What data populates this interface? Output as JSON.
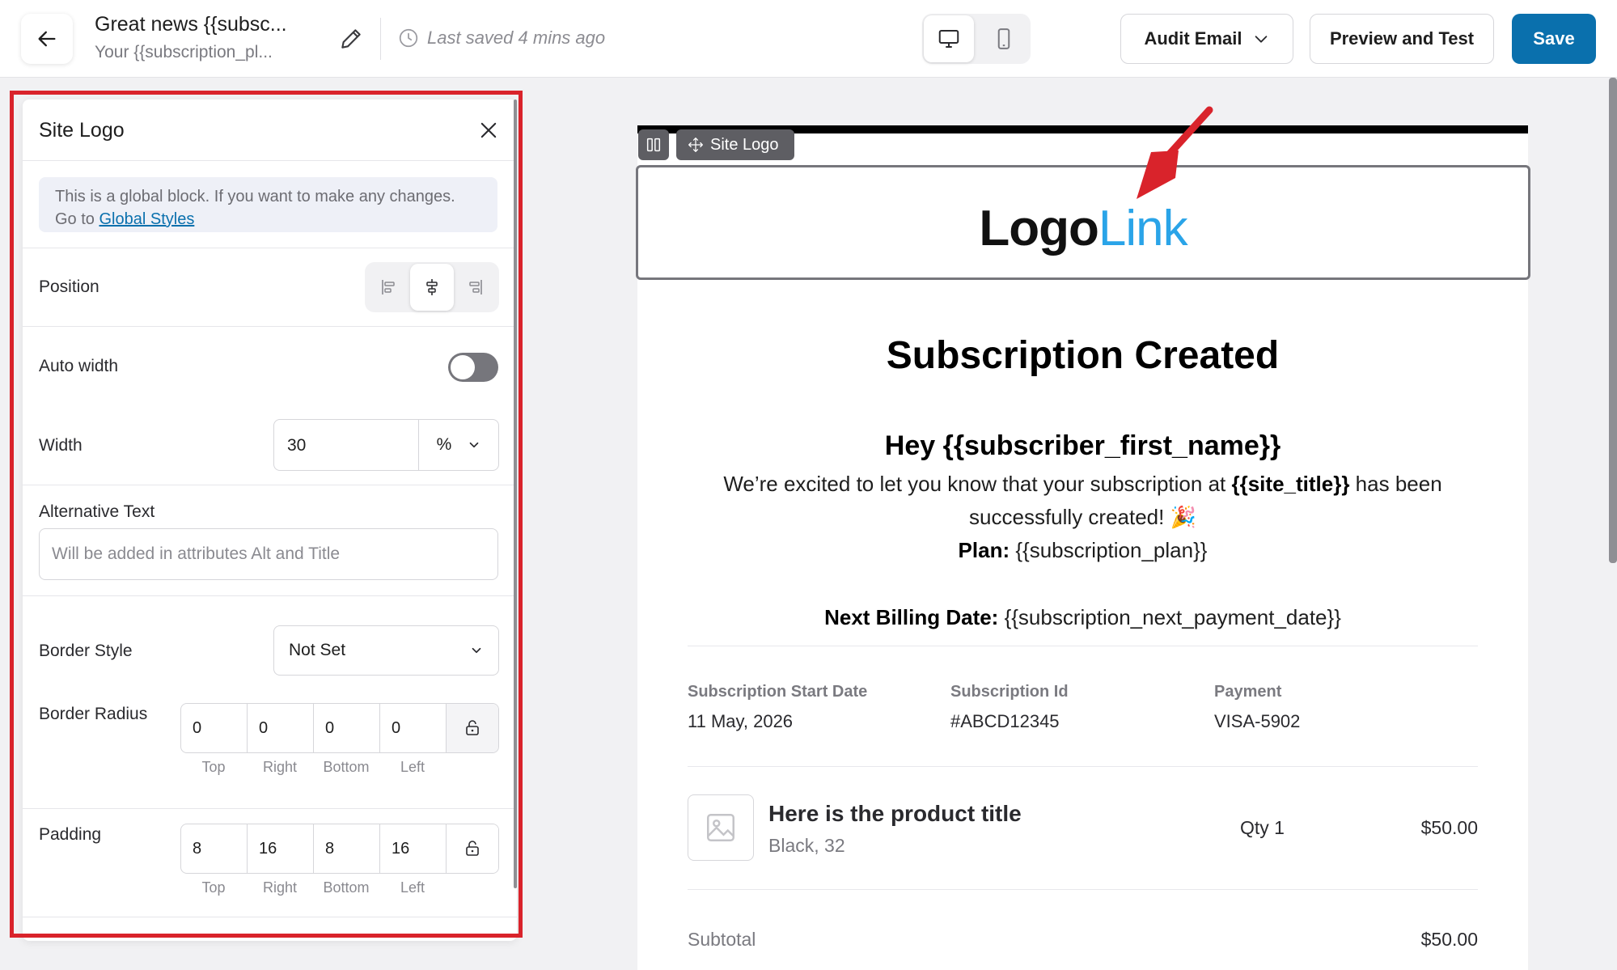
{
  "header": {
    "title": "Great news {{subsc...",
    "subtitle": "Your {{subscription_pl...",
    "saved_status": "Last saved 4 mins ago",
    "audit_label": "Audit Email",
    "preview_label": "Preview and Test",
    "save_label": "Save",
    "accent_color": "#0a70ad"
  },
  "panel": {
    "title": "Site Logo",
    "notice_text": "This is a global block. If you want to make any changes.",
    "notice_goto": "Go to",
    "notice_link": "Global Styles",
    "position_label": "Position",
    "position_selected": "center",
    "auto_width_label": "Auto width",
    "auto_width_on": false,
    "width_label": "Width",
    "width_value": "30",
    "width_unit": "%",
    "alt_label": "Alternative Text",
    "alt_placeholder": "Will be added in attributes Alt and Title",
    "border_style_label": "Border Style",
    "border_style_value": "Not Set",
    "border_radius_label": "Border Radius",
    "border_radius": {
      "top": "0",
      "right": "0",
      "bottom": "0",
      "left": "0"
    },
    "padding_label": "Padding",
    "padding": {
      "top": "8",
      "right": "16",
      "bottom": "8",
      "left": "16"
    },
    "side_labels": {
      "top": "Top",
      "right": "Right",
      "bottom": "Bottom",
      "left": "Left"
    }
  },
  "canvas": {
    "block_chip": "Site Logo",
    "logo_part1": "Logo",
    "logo_part2": "Link",
    "heading": "Subscription Created",
    "greeting": "Hey {{subscriber_first_name}}",
    "body_line1_pre": "We’re excited to let you know that your subscription at ",
    "body_line1_var": "{{site_title}}",
    "body_line1_post": " has been",
    "body_line2": "successfully created! 🎉",
    "plan_label": "Plan:",
    "plan_value": " {{subscription_plan}}",
    "billing_label": "Next Billing Date:",
    "billing_value": " {{subscription_next_payment_date}}",
    "meta": [
      {
        "key": "Subscription Start Date",
        "value": "11 May, 2026"
      },
      {
        "key": "Subscription Id",
        "value": "#ABCD12345"
      },
      {
        "key": "Payment",
        "value": "VISA-5902"
      }
    ],
    "product": {
      "title": "Here is the product title",
      "variant": "Black, 32",
      "qty": "Qty 1",
      "price": "$50.00"
    },
    "subtotal_label": "Subtotal",
    "subtotal_value": "$50.00"
  }
}
